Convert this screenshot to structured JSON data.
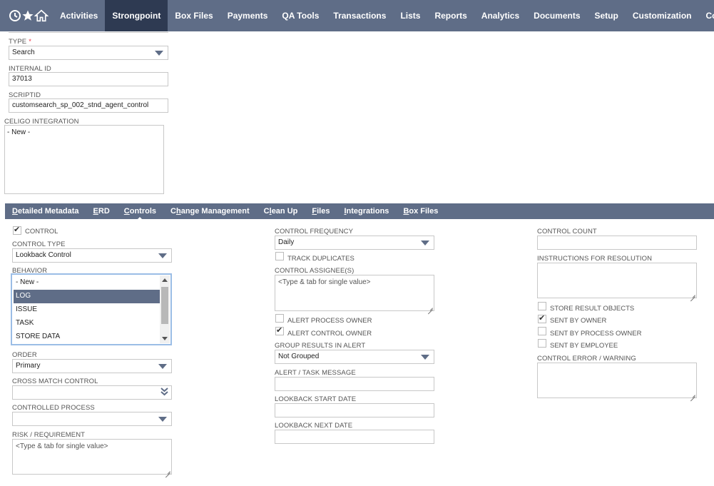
{
  "topnav": {
    "icons": [
      "recent-icon",
      "star-icon",
      "home-icon"
    ],
    "items": [
      "Activities",
      "Strongpoint",
      "Box Files",
      "Payments",
      "QA Tools",
      "Transactions",
      "Lists",
      "Reports",
      "Analytics",
      "Documents",
      "Setup",
      "Customization",
      "Co"
    ],
    "active": "Strongpoint"
  },
  "form": {
    "type_label": "TYPE",
    "type_value": "Search",
    "internal_id_label": "INTERNAL ID",
    "internal_id_value": "37013",
    "scriptid_label": "SCRIPTID",
    "scriptid_value": "customsearch_sp_002_stnd_agent_control",
    "celigo_label": "CELIGO INTEGRATION",
    "celigo_value": "- New -"
  },
  "tabs": [
    "Detailed Metadata",
    "ERD",
    "Controls",
    "Change Management",
    "Clean Up",
    "Files",
    "Integrations",
    "Box Files"
  ],
  "tabs_underline": [
    "D",
    "E",
    "C",
    "h",
    "l",
    "F",
    "I",
    "B"
  ],
  "active_tab": "Controls",
  "col1": {
    "control_label": "CONTROL",
    "control_type_label": "CONTROL TYPE",
    "control_type_value": "Lookback Control",
    "behavior_label": "BEHAVIOR",
    "behavior_options": [
      "- New -",
      "LOG",
      "ISSUE",
      "TASK",
      "STORE DATA"
    ],
    "behavior_selected": "LOG",
    "order_label": "ORDER",
    "order_value": "Primary",
    "cross_match_label": "CROSS MATCH CONTROL",
    "controlled_process_label": "CONTROLLED PROCESS",
    "risk_label": "RISK / REQUIREMENT",
    "risk_placeholder": "<Type & tab for single value>"
  },
  "col2": {
    "frequency_label": "CONTROL FREQUENCY",
    "frequency_value": "Daily",
    "track_duplicates_label": "TRACK DUPLICATES",
    "assignee_label": "CONTROL ASSIGNEE(S)",
    "assignee_placeholder": "<Type & tab for single value>",
    "alert_process_owner_label": "ALERT PROCESS OWNER",
    "alert_control_owner_label": "ALERT CONTROL OWNER",
    "group_results_label": "GROUP RESULTS IN ALERT",
    "group_results_value": "Not Grouped",
    "alert_task_message_label": "ALERT / TASK MESSAGE",
    "lookback_start_label": "LOOKBACK START DATE",
    "lookback_next_label": "LOOKBACK NEXT DATE"
  },
  "col3": {
    "control_count_label": "CONTROL COUNT",
    "instructions_label": "INSTRUCTIONS FOR RESOLUTION",
    "store_result_label": "STORE RESULT OBJECTS",
    "sent_by_owner_label": "SENT BY OWNER",
    "sent_by_process_owner_label": "SENT BY PROCESS OWNER",
    "sent_by_employee_label": "SENT BY EMPLOYEE",
    "control_error_label": "CONTROL ERROR / WARNING"
  }
}
